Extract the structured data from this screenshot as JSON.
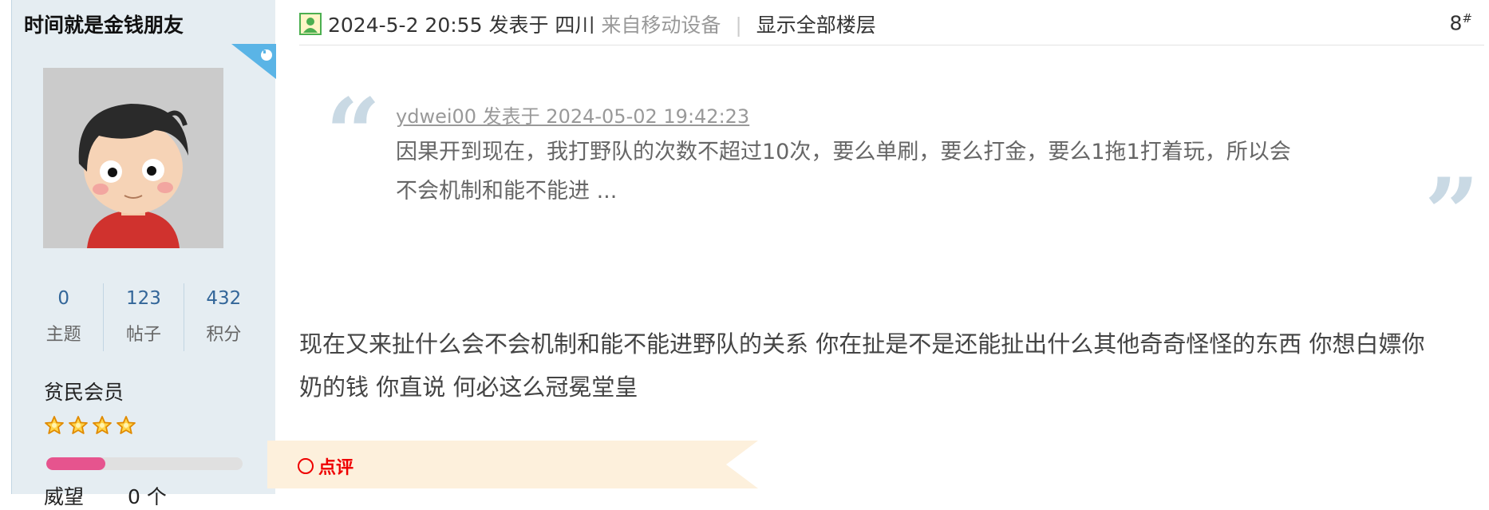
{
  "author": {
    "username": "时间就是金钱朋友",
    "stats": [
      {
        "value": "0",
        "label": "主题"
      },
      {
        "value": "123",
        "label": "帖子"
      },
      {
        "value": "432",
        "label": "积分"
      }
    ],
    "group": "贫民会员",
    "star_count": 4,
    "progress_percent": 30,
    "partial_stat": {
      "label": "威望",
      "value": "0 个"
    }
  },
  "post_header": {
    "time": "2024-5-2 20:55",
    "posted_at": "发表于",
    "location": "四川",
    "source": "来自移动设备",
    "separator": "|",
    "show_all": "显示全部楼层",
    "floor_number": "8",
    "floor_mark": "#"
  },
  "quote": {
    "author_line": "ydwei00 发表于 2024-05-02 19:42:23",
    "line1": "因果开到现在，我打野队的次数不超过10次，要么单刷，要么打金，要么1拖1打着玩，所以会",
    "line2": "不会机制和能不能进 ..."
  },
  "post_body": {
    "line1": "现在又来扯什么会不会机制和能不能进野队的关系 你在扯是不是还能扯出什么其他奇奇怪怪的东西 你想白嫖你",
    "line2": "奶的钱 你直说 何必这么冠冕堂皇"
  },
  "comment": {
    "label": "点评"
  },
  "colors": {
    "sidebar_bg": "#e5edf2",
    "link_blue": "#336699",
    "progress_pink": "#e6548e",
    "comment_red": "#ee0000",
    "banner_bg": "#fdf0dc"
  }
}
